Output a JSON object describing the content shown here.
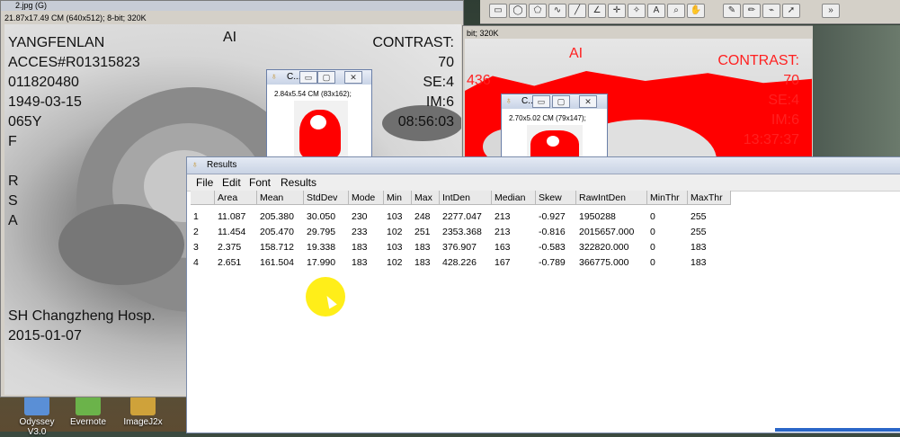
{
  "main_window": {
    "title": "2.jpg (G)",
    "info": "21.87x17.49 CM (640x512); 8-bit; 320K",
    "left_overlay": [
      "YANGFENLAN",
      "ACCES#R01315823",
      "011820480",
      "1949-03-15",
      "065Y",
      "F",
      "",
      "R",
      "S",
      "A"
    ],
    "top_label": "AI",
    "right_overlay": [
      "CONTRAST:",
      "70",
      "SE:4",
      "IM:6",
      "08:56:03"
    ],
    "bottom_overlay": [
      "SH Changzheng Hosp.",
      "2015-01-07"
    ]
  },
  "second_window": {
    "info": "bit; 320K",
    "top_label": "AI",
    "left_number": "436",
    "right_overlay": [
      "CONTRAST:",
      "70",
      "SE:4",
      "IM:6",
      "13:37:37"
    ]
  },
  "roi_window_1": {
    "title": "C...",
    "info": "2.84x5.54 CM (83x162);"
  },
  "roi_window_2": {
    "title": "C...",
    "info": "2.70x5.02 CM (79x147);"
  },
  "window_buttons": {
    "minimize": "▭",
    "maximize": "▢",
    "close": "✕"
  },
  "results_window": {
    "title": "Results",
    "menu": [
      "File",
      "Edit",
      "Font",
      "Results"
    ],
    "columns": [
      "",
      "Area",
      "Mean",
      "StdDev",
      "Mode",
      "Min",
      "Max",
      "IntDen",
      "Median",
      "Skew",
      "RawIntDen",
      "MinThr",
      "MaxThr"
    ],
    "rows": [
      [
        "1",
        "11.087",
        "205.380",
        "30.050",
        "230",
        "103",
        "248",
        "2277.047",
        "213",
        "-0.927",
        "1950288",
        "0",
        "255"
      ],
      [
        "2",
        "11.454",
        "205.470",
        "29.795",
        "233",
        "102",
        "251",
        "2353.368",
        "213",
        "-0.816",
        "2015657.000",
        "0",
        "255"
      ],
      [
        "3",
        "2.375",
        "158.712",
        "19.338",
        "183",
        "103",
        "183",
        "376.907",
        "163",
        "-0.583",
        "322820.000",
        "0",
        "183"
      ],
      [
        "4",
        "2.651",
        "161.504",
        "17.990",
        "183",
        "102",
        "183",
        "428.226",
        "167",
        "-0.789",
        "366775.000",
        "0",
        "183"
      ]
    ]
  },
  "desktop_icons": [
    {
      "label": "Odyssey V3.0",
      "icon": "odyssey-icon"
    },
    {
      "label": "Evernote",
      "icon": "evernote-icon"
    },
    {
      "label": "ImageJ2x",
      "icon": "imagej-icon"
    }
  ],
  "colors": {
    "threshold_red": "#ff0000",
    "results_title": "#c9d3e4",
    "cursor_highlight": "#ffec00"
  }
}
